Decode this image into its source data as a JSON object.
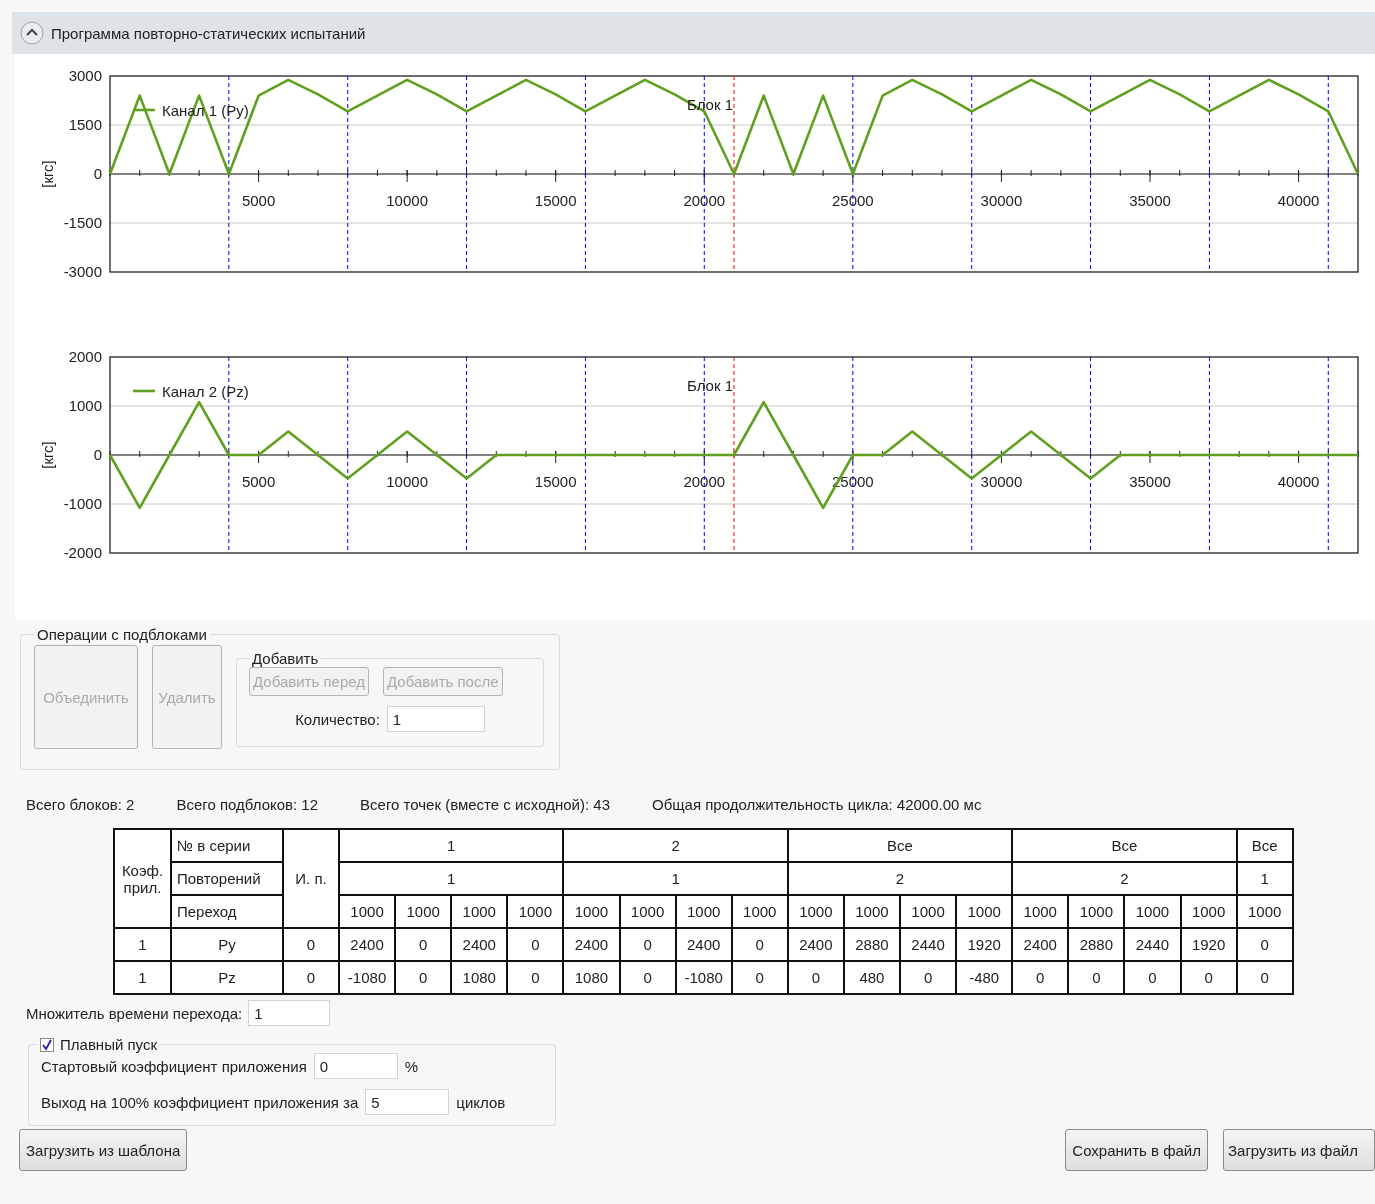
{
  "panel": {
    "title": "Программа повторно-статических испытаний",
    "expanded": true
  },
  "charts": [
    {
      "chart_data": {
        "type": "line",
        "ylabel": "[кгс]",
        "x": [
          0,
          1000,
          2000,
          3000,
          4000,
          5000,
          6000,
          7000,
          8000,
          9000,
          10000,
          11000,
          12000,
          13000,
          14000,
          15000,
          16000,
          17000,
          18000,
          19000,
          20000,
          21000,
          22000,
          23000,
          24000,
          25000,
          26000,
          27000,
          28000,
          29000,
          30000,
          31000,
          32000,
          33000,
          34000,
          35000,
          36000,
          37000,
          38000,
          39000,
          40000,
          41000,
          42000
        ],
        "xlim": [
          0,
          42000
        ],
        "ylim": [
          -3000,
          3000
        ],
        "xticks": [
          5000,
          10000,
          15000,
          20000,
          25000,
          30000,
          35000,
          40000
        ],
        "yticks": [
          -3000,
          -1500,
          0,
          1500,
          3000
        ],
        "series": [
          {
            "name": "Канал 1 (Py)",
            "color": "#5fa11e",
            "values": [
              0,
              2400,
              0,
              2400,
              0,
              2400,
              2880,
              2440,
              1920,
              2400,
              2880,
              2440,
              1920,
              2400,
              2880,
              2440,
              1920,
              2400,
              2880,
              2440,
              1920,
              0,
              2400,
              0,
              2400,
              0,
              2400,
              2880,
              2440,
              1920,
              2400,
              2880,
              2440,
              1920,
              2400,
              2880,
              2440,
              1920,
              2400,
              2880,
              2440,
              1920,
              0
            ]
          }
        ],
        "grid": true,
        "ref_lines": [
          {
            "axis": "x",
            "value": 4000,
            "color": "#0000ff"
          },
          {
            "axis": "x",
            "value": 8000,
            "color": "#0000ff"
          },
          {
            "axis": "x",
            "value": 12000,
            "color": "#0000ff"
          },
          {
            "axis": "x",
            "value": 16000,
            "color": "#0000ff"
          },
          {
            "axis": "x",
            "value": 20000,
            "color": "#0000ff"
          },
          {
            "axis": "x",
            "value": 21000,
            "color": "#ff0000",
            "label": "Блок 1"
          },
          {
            "axis": "x",
            "value": 25000,
            "color": "#0000ff"
          },
          {
            "axis": "x",
            "value": 29000,
            "color": "#0000ff"
          },
          {
            "axis": "x",
            "value": 33000,
            "color": "#0000ff"
          },
          {
            "axis": "x",
            "value": 37000,
            "color": "#0000ff"
          },
          {
            "axis": "x",
            "value": 41000,
            "color": "#0000ff"
          }
        ]
      }
    },
    {
      "chart_data": {
        "type": "line",
        "ylabel": "[кгс]",
        "x": [
          0,
          1000,
          2000,
          3000,
          4000,
          5000,
          6000,
          7000,
          8000,
          9000,
          10000,
          11000,
          12000,
          13000,
          14000,
          15000,
          16000,
          17000,
          18000,
          19000,
          20000,
          21000,
          22000,
          23000,
          24000,
          25000,
          26000,
          27000,
          28000,
          29000,
          30000,
          31000,
          32000,
          33000,
          34000,
          35000,
          36000,
          37000,
          38000,
          39000,
          40000,
          41000,
          42000
        ],
        "xlim": [
          0,
          42000
        ],
        "ylim": [
          -2000,
          2000
        ],
        "xticks": [
          5000,
          10000,
          15000,
          20000,
          25000,
          30000,
          35000,
          40000
        ],
        "yticks": [
          -2000,
          -1000,
          0,
          1000,
          2000
        ],
        "series": [
          {
            "name": "Канал 2 (Pz)",
            "color": "#5fa11e",
            "values": [
              0,
              -1080,
              0,
              1080,
              0,
              0,
              480,
              0,
              -480,
              0,
              480,
              0,
              -480,
              0,
              0,
              0,
              0,
              0,
              0,
              0,
              0,
              0,
              1080,
              0,
              -1080,
              0,
              0,
              480,
              0,
              -480,
              0,
              480,
              0,
              -480,
              0,
              0,
              0,
              0,
              0,
              0,
              0,
              0,
              0
            ]
          }
        ],
        "grid": true,
        "ref_lines": [
          {
            "axis": "x",
            "value": 4000,
            "color": "#0000ff"
          },
          {
            "axis": "x",
            "value": 8000,
            "color": "#0000ff"
          },
          {
            "axis": "x",
            "value": 12000,
            "color": "#0000ff"
          },
          {
            "axis": "x",
            "value": 16000,
            "color": "#0000ff"
          },
          {
            "axis": "x",
            "value": 20000,
            "color": "#0000ff"
          },
          {
            "axis": "x",
            "value": 21000,
            "color": "#ff0000",
            "label": "Блок 1"
          },
          {
            "axis": "x",
            "value": 25000,
            "color": "#0000ff"
          },
          {
            "axis": "x",
            "value": 29000,
            "color": "#0000ff"
          },
          {
            "axis": "x",
            "value": 33000,
            "color": "#0000ff"
          },
          {
            "axis": "x",
            "value": 37000,
            "color": "#0000ff"
          },
          {
            "axis": "x",
            "value": 41000,
            "color": "#0000ff"
          }
        ]
      }
    }
  ],
  "suboperations": {
    "title": "Операции с подблоками",
    "buttons": [
      {
        "label": "Объединить",
        "disabled": true
      },
      {
        "label": "Удалить",
        "disabled": true
      }
    ],
    "add_group": {
      "title": "Добавить",
      "buttons": [
        {
          "label": "Добавить перед",
          "disabled": true
        },
        {
          "label": "Добавить после",
          "disabled": true
        }
      ],
      "quantity_label": "Количество:",
      "quantity": "1"
    }
  },
  "stats": [
    "Всего блоков: 2",
    "Всего подблоков: 12",
    "Всего точек (вместе с исходной): 43",
    "Общая продолжительность цикла: 42000.00 мс"
  ],
  "table": {
    "coef_header": "Коэф. прил.",
    "series_header": "№ в серии",
    "repeats_header": "Повторений",
    "transition_header": "Переход",
    "initial_header": "И. п.",
    "groups": [
      {
        "series": "1",
        "repeats": "1",
        "transitions": [
          "1000",
          "1000",
          "1000",
          "1000"
        ]
      },
      {
        "series": "2",
        "repeats": "1",
        "transitions": [
          "1000",
          "1000",
          "1000",
          "1000"
        ]
      },
      {
        "series": "Все",
        "repeats": "2",
        "transitions": [
          "1000",
          "1000",
          "1000",
          "1000"
        ]
      },
      {
        "series": "Все",
        "repeats": "2",
        "transitions": [
          "1000",
          "1000",
          "1000",
          "1000"
        ]
      },
      {
        "series": "Все",
        "repeats": "1",
        "transitions": [
          "1000"
        ]
      }
    ],
    "rows": [
      {
        "coef": "1",
        "channel": "Py",
        "initial": "0",
        "values": [
          "2400",
          "0",
          "2400",
          "0",
          "2400",
          "0",
          "2400",
          "0",
          "2400",
          "2880",
          "2440",
          "1920",
          "2400",
          "2880",
          "2440",
          "1920",
          "0"
        ]
      },
      {
        "coef": "1",
        "channel": "Pz",
        "initial": "0",
        "values": [
          "-1080",
          "0",
          "1080",
          "0",
          "1080",
          "0",
          "-1080",
          "0",
          "0",
          "480",
          "0",
          "-480",
          "0",
          "0",
          "0",
          "0",
          "0"
        ]
      }
    ]
  },
  "time_multiplier": {
    "label": "Множитель времени перехода:",
    "value": "1"
  },
  "soft_start": {
    "label": "Плавный пуск",
    "checked": true,
    "start_label": "Стартовый коэффициент приложения",
    "start_value": "0",
    "start_unit": "%",
    "ramp_label": "Выход на 100% коэффициент приложения за",
    "ramp_value": "5",
    "ramp_unit": "циклов"
  },
  "buttons_left": [
    "Загрузить из шаблона"
  ],
  "buttons_right": [
    "Сохранить в файл",
    "Загрузить из файл"
  ]
}
